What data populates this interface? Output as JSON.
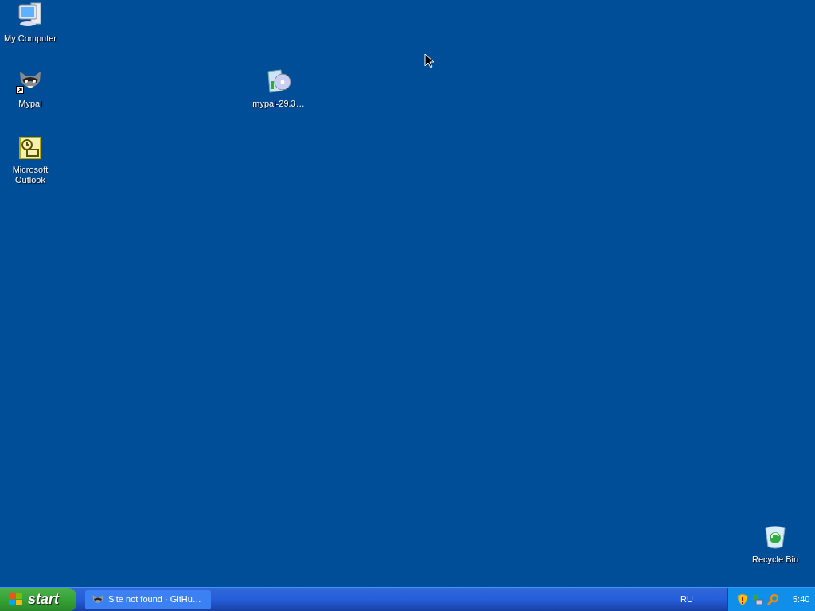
{
  "desktop_icons": [
    {
      "label": "My Computer",
      "kind": "computer",
      "shortcut": false
    },
    {
      "label": "Mypal",
      "kind": "raccoon",
      "shortcut": true
    },
    {
      "label": "Microsoft Outlook",
      "kind": "outlook",
      "shortcut": false
    },
    {
      "label": "mypal-29.3…",
      "kind": "installer",
      "shortcut": false
    },
    {
      "label": "Recycle Bin",
      "kind": "recycle",
      "shortcut": false
    }
  ],
  "taskbar": {
    "start": "start",
    "tasks": [
      {
        "label": "Site not found · GitHu…",
        "selected": false
      }
    ],
    "language": "RU",
    "tray": [
      {
        "kind": "shield"
      },
      {
        "kind": "network"
      },
      {
        "kind": "search"
      }
    ],
    "clock": "5:40"
  }
}
